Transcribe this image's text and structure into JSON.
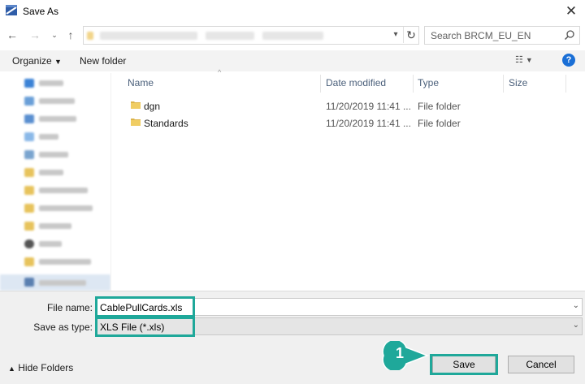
{
  "window": {
    "title": "Save As"
  },
  "navigation": {
    "address_placeholder": "",
    "search_placeholder": "Search BRCM_EU_EN"
  },
  "toolbar": {
    "organize_label": "Organize",
    "new_folder_label": "New folder"
  },
  "columns": {
    "name": "Name",
    "date": "Date modified",
    "type": "Type",
    "size": "Size"
  },
  "files": [
    {
      "name": "dgn",
      "date": "11/20/2019 11:41 ...",
      "type": "File folder"
    },
    {
      "name": "Standards",
      "date": "11/20/2019 11:41 ...",
      "type": "File folder"
    }
  ],
  "form": {
    "file_name_label": "File name:",
    "file_name_value": "CablePullCards.xls",
    "save_type_label": "Save as type:",
    "save_type_value": "XLS File (*.xls)"
  },
  "footer": {
    "hide_folders_label": "Hide Folders",
    "save_label": "Save",
    "cancel_label": "Cancel"
  },
  "callout": {
    "number": "1"
  },
  "colors": {
    "highlight": "#1fa89a",
    "folder": "#dcb44a",
    "accent": "#1a6fd6"
  },
  "icons": [
    "app-icon",
    "close-icon",
    "back-icon",
    "forward-icon",
    "recent-icon",
    "up-icon",
    "refresh-icon",
    "search-icon",
    "view-icon",
    "help-icon",
    "folder-icon",
    "chevron-up-icon"
  ]
}
